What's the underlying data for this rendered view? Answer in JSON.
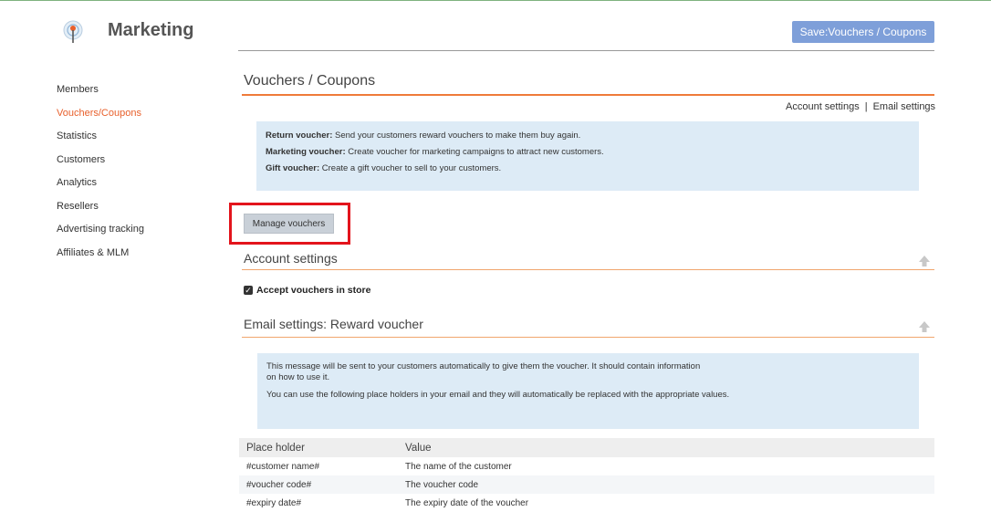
{
  "header": {
    "app_title": "Marketing",
    "save_label": "Save:Vouchers / Coupons",
    "accent_color": "#7e9fd9"
  },
  "sidebar": {
    "items": [
      {
        "label": "Members",
        "active": false
      },
      {
        "label": "Vouchers/Coupons",
        "active": true
      },
      {
        "label": "Statistics",
        "active": false
      },
      {
        "label": "Customers",
        "active": false
      },
      {
        "label": "Analytics",
        "active": false
      },
      {
        "label": "Resellers",
        "active": false
      },
      {
        "label": "Advertising tracking",
        "active": false
      },
      {
        "label": "Affiliates & MLM",
        "active": false
      }
    ],
    "active_color": "#e8602c"
  },
  "main": {
    "page_title": "Vouchers / Coupons",
    "links": {
      "account_settings": "Account settings",
      "separator": "|",
      "email_settings": "Email settings"
    },
    "intro": {
      "return_title": "Return voucher:",
      "return_text": " Send your customers reward vouchers to make them buy again.",
      "marketing_title": "Marketing voucher:",
      "marketing_text": " Create voucher for marketing campaigns to attract new customers.",
      "gift_title": "Gift voucher:",
      "gift_text": " Create a gift voucher to sell to your customers."
    },
    "manage_label": "Manage vouchers",
    "account_section": {
      "title": "Account settings",
      "checkbox_label": "Accept vouchers in store",
      "checked": true
    },
    "email_section": {
      "title": "Email settings: Reward voucher",
      "info_line1": "This message will be sent to your customers automatically to give them the voucher. It should contain information on how to use it.",
      "info_line2": "You can use the following place holders in your email and they will automatically be replaced with the appropriate values."
    },
    "placeholder_table": {
      "headers": [
        "Place holder",
        "Value"
      ],
      "rows": [
        [
          "#customer name#",
          "The name of the customer"
        ],
        [
          "#voucher code#",
          "The voucher code"
        ],
        [
          "#expiry date#",
          "The expiry date of the voucher"
        ]
      ]
    }
  }
}
